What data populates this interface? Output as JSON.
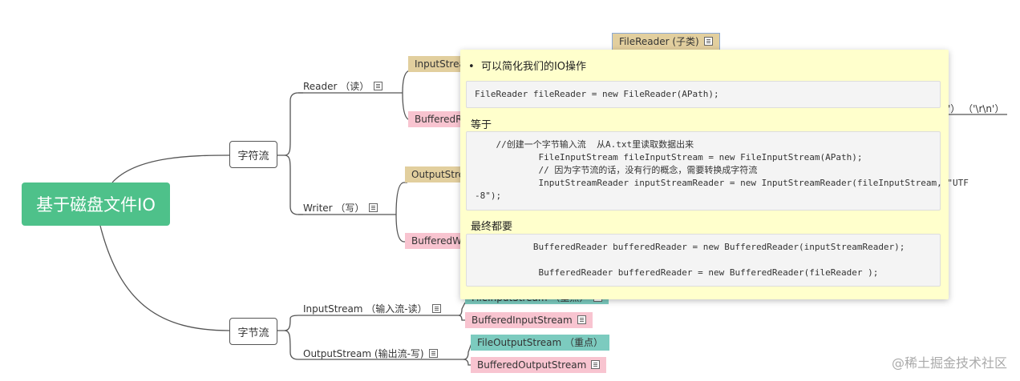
{
  "root": "基于磁盘文件IO",
  "char_stream": {
    "label": "字符流",
    "reader": "Reader （读）",
    "writer": "Writer （写）",
    "input_stream": "InputStream",
    "buffered_reader": "BufferedR",
    "output_stream": "OutputStre",
    "buffered_writer": "BufferedW",
    "file_reader": "FileReader (子类)",
    "newline_note": "'）  （'\\r\\n'）"
  },
  "byte_stream": {
    "label": "字节流",
    "input_stream": "InputStream （输入流-读）",
    "output_stream": "OutputStream (输出流-写)",
    "file_input_stream": "FileInputStream （重点）",
    "buffered_input_stream": "BufferedInputStream",
    "file_output_stream": "FileOutputStream （重点）",
    "buffered_output_stream": "BufferedOutputStream"
  },
  "popup": {
    "bullet": "可以简化我们的IO操作",
    "code1": "FileReader fileReader = new FileReader(APath);",
    "equals": "等于",
    "code2": "    //创建一个字节输入流  从A.txt里读取数据出来\n            FileInputStream fileInputStream = new FileInputStream(APath);\n            // 因为字节流的话，没有行的概念，需要转换成字符流\n            InputStreamReader inputStreamReader = new InputStreamReader(fileInputStream, \"UTF\n-8\");",
    "finally": "最终都要",
    "code3": "           BufferedReader bufferedReader = new BufferedReader(inputStreamReader);\n\n            BufferedReader bufferedReader = new BufferedReader(fileReader );"
  },
  "watermark": "@稀土掘金技术社区"
}
